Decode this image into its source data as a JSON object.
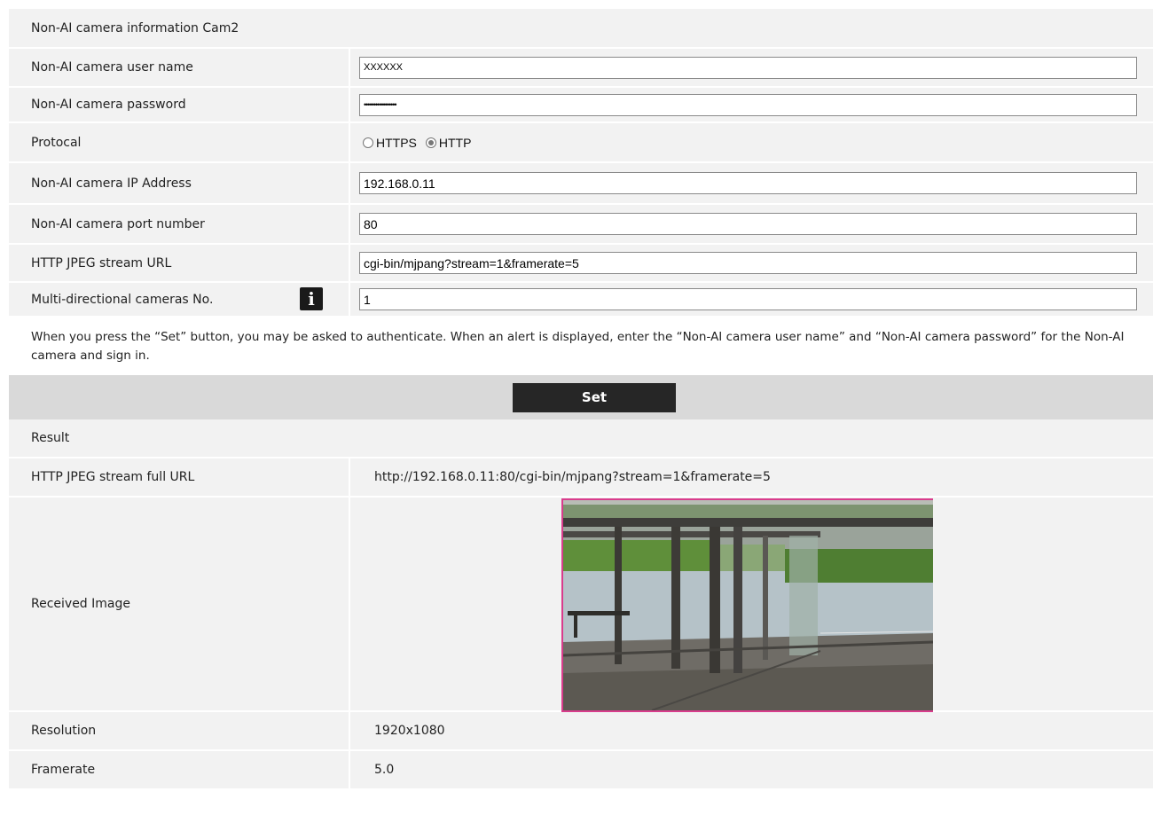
{
  "section_title": "Non-AI camera information Cam2",
  "fields": {
    "user_name": {
      "label": "Non-AI camera user name",
      "value": "XXXXXX"
    },
    "password": {
      "label": "Non-AI camera password",
      "value": "•••••••••••••••••"
    },
    "protocol": {
      "label": "Protocal",
      "options": [
        "HTTPS",
        "HTTP"
      ],
      "selected": "HTTP"
    },
    "ip_address": {
      "label": "Non-AI camera IP Address",
      "value": "192.168.0.11"
    },
    "port": {
      "label": "Non-AI camera port number",
      "value": "80"
    },
    "stream_url": {
      "label": "HTTP JPEG stream URL",
      "value": "cgi-bin/mjpang?stream=1&framerate=5"
    },
    "multi_dir": {
      "label": "Multi-directional cameras No.",
      "value": "1",
      "info_icon": "info-icon",
      "info_glyph": "i"
    }
  },
  "note": "When you press the “Set” button, you may be asked to authenticate. When an alert is displayed, enter the “Non-AI camera user name” and “Non-AI camera password” for the Non-AI camera and sign in.",
  "set_button": "Set",
  "result": {
    "title": "Result",
    "full_url": {
      "label": "HTTP JPEG stream full URL",
      "value": "http://192.168.0.11:80/cgi-bin/mjpang?stream=1&framerate=5"
    },
    "received_image": {
      "label": "Received Image"
    },
    "resolution": {
      "label": "Resolution",
      "value": "1920x1080"
    },
    "framerate": {
      "label": "Framerate",
      "value": "5.0"
    }
  }
}
